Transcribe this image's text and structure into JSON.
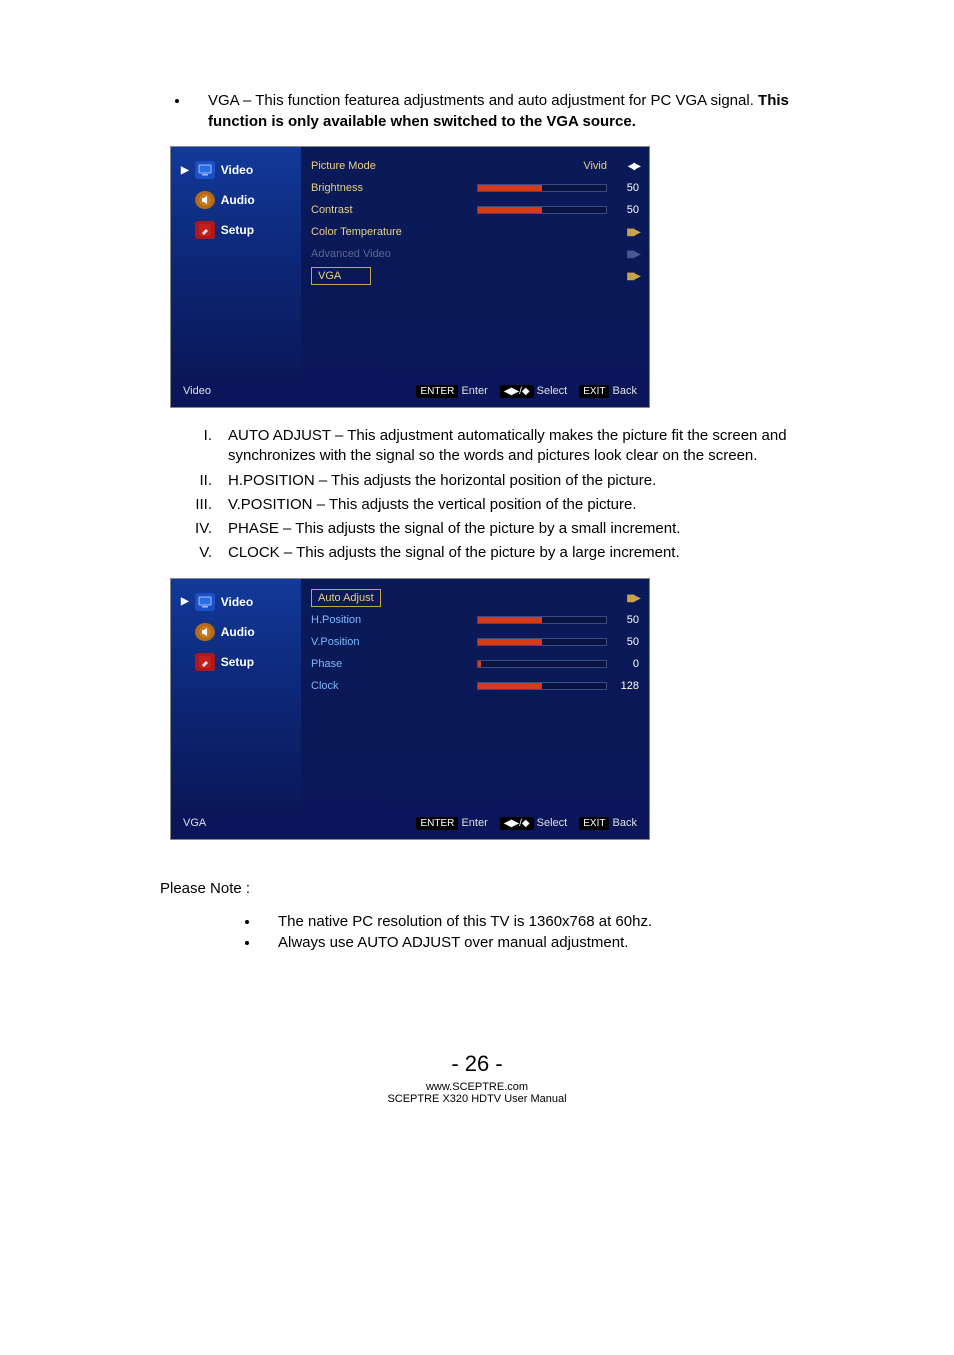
{
  "intro": {
    "lead": "VGA – This function featurea adjustments and auto adjustment for PC VGA signal.  ",
    "bold": "This function is only available when switched to the VGA source."
  },
  "osd1": {
    "side": {
      "video": "Video",
      "audio": "Audio",
      "setup": "Setup"
    },
    "rows": {
      "picture_mode": {
        "label": "Picture Mode",
        "value": "Vivid"
      },
      "brightness": {
        "label": "Brightness",
        "value": 50
      },
      "contrast": {
        "label": "Contrast",
        "value": 50
      },
      "color_temp": {
        "label": "Color Temperature"
      },
      "advanced": {
        "label": "Advanced Video"
      },
      "vga": {
        "label": "VGA"
      }
    },
    "footer": {
      "left": "Video",
      "enter_k": "ENTER",
      "enter_t": "Enter",
      "select_t": "Select",
      "exit_k": "EXIT",
      "exit_t": "Back"
    }
  },
  "defs": {
    "i": {
      "n": "I.",
      "t": "AUTO ADJUST – This adjustment automatically makes the picture fit the screen and synchronizes with the signal so the words and pictures look clear on the screen."
    },
    "ii": {
      "n": "II.",
      "t": "H.POSITION – This adjusts the horizontal position of the picture."
    },
    "iii": {
      "n": "III.",
      "t": "V.POSITION – This adjusts the vertical position of the picture."
    },
    "iv": {
      "n": "IV.",
      "t": "PHASE – This adjusts the signal of the picture by a small increment."
    },
    "v": {
      "n": "V.",
      "t": "CLOCK – This adjusts the signal of the picture by a large increment."
    }
  },
  "osd2": {
    "side": {
      "video": "Video",
      "audio": "Audio",
      "setup": "Setup"
    },
    "rows": {
      "auto": {
        "label": "Auto Adjust"
      },
      "hpos": {
        "label": "H.Position",
        "value": 50
      },
      "vpos": {
        "label": "V.Position",
        "value": 50
      },
      "phase": {
        "label": "Phase",
        "value": 0
      },
      "clock": {
        "label": "Clock",
        "value": 128
      }
    },
    "footer": {
      "left": "VGA",
      "enter_k": "ENTER",
      "enter_t": "Enter",
      "select_t": "Select",
      "exit_k": "EXIT",
      "exit_t": "Back"
    }
  },
  "note_label": "Please Note :",
  "notes": {
    "a": "The native PC resolution of this TV is 1360x768 at 60hz.",
    "b": "Always use AUTO ADJUST over manual adjustment."
  },
  "footer": {
    "page": "- 26 -",
    "url": "www.SCEPTRE.com",
    "manual": "SCEPTRE X320 HDTV User Manual"
  },
  "chart_data": [
    {
      "type": "bar",
      "title": "Video OSD sliders",
      "categories": [
        "Brightness",
        "Contrast"
      ],
      "values": [
        50,
        50
      ],
      "ylim": [
        0,
        100
      ]
    },
    {
      "type": "bar",
      "title": "VGA OSD sliders",
      "categories": [
        "H.Position",
        "V.Position",
        "Phase",
        "Clock"
      ],
      "values": [
        50,
        50,
        0,
        128
      ],
      "ylim": [
        0,
        255
      ]
    }
  ]
}
